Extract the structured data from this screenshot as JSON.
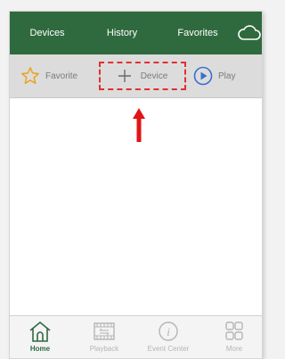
{
  "tabs": [
    {
      "label": "Devices"
    },
    {
      "label": "History"
    },
    {
      "label": "Favorites"
    }
  ],
  "toolbar": {
    "favorite_label": "Favorite",
    "device_label": "Device",
    "play_label": "Play"
  },
  "bottom_nav": [
    {
      "label": "Home",
      "icon": "home-icon"
    },
    {
      "label": "Playback",
      "icon": "film-icon"
    },
    {
      "label": "Event Center",
      "icon": "info-icon"
    },
    {
      "label": "More",
      "icon": "grid-icon"
    }
  ],
  "colors": {
    "header": "#2f6a3e",
    "toolbar": "#dcdcdc",
    "highlight": "#e03030",
    "play_accent": "#3a6fd0",
    "star": "#e9a11a"
  }
}
